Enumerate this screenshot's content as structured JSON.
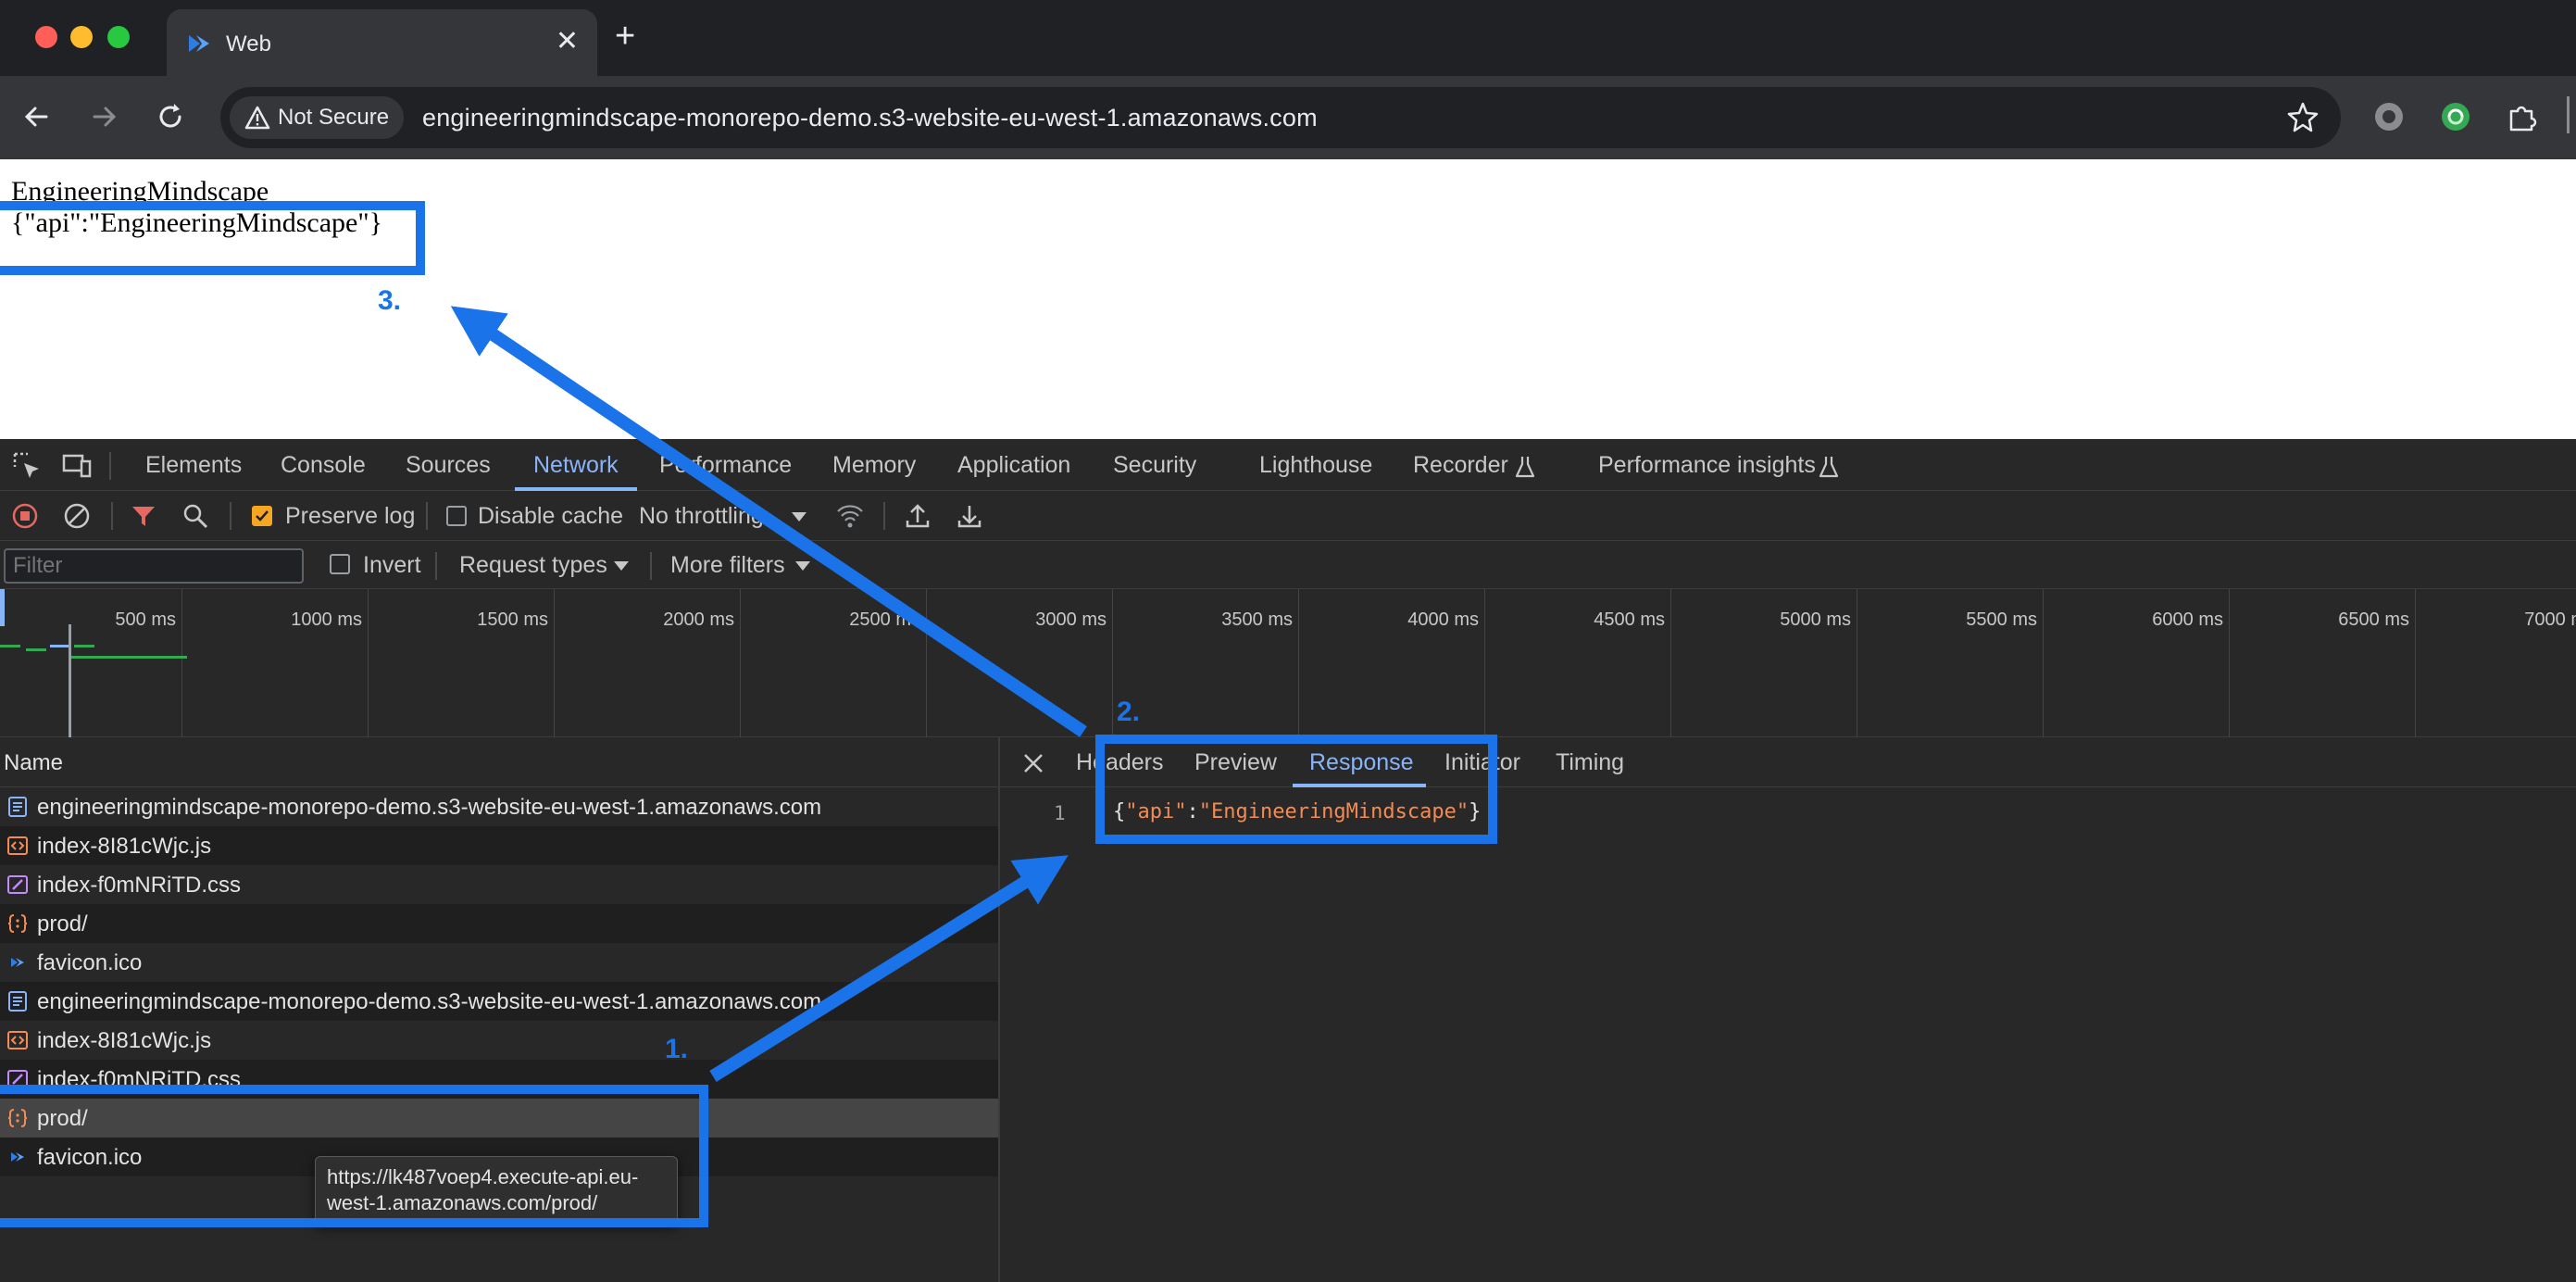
{
  "browser": {
    "tab_title": "Web",
    "tab_close": "✕",
    "new_tab": "+",
    "security_label": "Not Secure",
    "url": "engineeringmindscape-monorepo-demo.s3-website-eu-west-1.amazonaws.com"
  },
  "page": {
    "heading": "EngineeringMindscape",
    "json_text": "{\"api\":\"EngineeringMindscape\"}"
  },
  "devtools": {
    "tabs": [
      "Elements",
      "Console",
      "Sources",
      "Network",
      "Performance",
      "Memory",
      "Application",
      "Security",
      "Lighthouse",
      "Recorder",
      "Performance insights"
    ],
    "active_tab": "Network",
    "controls": {
      "preserve_log": "Preserve log",
      "disable_cache": "Disable cache",
      "throttling": "No throttling"
    },
    "filter": {
      "placeholder": "Filter",
      "invert": "Invert",
      "request_types": "Request types",
      "more_filters": "More filters"
    },
    "timeline_ticks": [
      "500 ms",
      "1000 ms",
      "1500 ms",
      "2000 ms",
      "2500 ms",
      "3000 ms",
      "3500 ms",
      "4000 ms",
      "4500 ms",
      "5000 ms",
      "5500 ms",
      "6000 ms",
      "6500 ms",
      "7000 ms"
    ],
    "name_header": "Name",
    "requests": [
      {
        "name": "engineeringmindscape-monorepo-demo.s3-website-eu-west-1.amazonaws.com",
        "type": "document"
      },
      {
        "name": "index-8I81cWjc.js",
        "type": "script"
      },
      {
        "name": "index-f0mNRiTD.css",
        "type": "stylesheet"
      },
      {
        "name": "prod/",
        "type": "fetch"
      },
      {
        "name": "favicon.ico",
        "type": "image"
      },
      {
        "name": "engineeringmindscape-monorepo-demo.s3-website-eu-west-1.amazonaws.com",
        "type": "document"
      },
      {
        "name": "index-8I81cWjc.js",
        "type": "script"
      },
      {
        "name": "index-f0mNRiTD.css",
        "type": "stylesheet"
      },
      {
        "name": "prod/",
        "type": "fetch"
      },
      {
        "name": "favicon.ico",
        "type": "image"
      }
    ],
    "detail_tabs": [
      "Headers",
      "Preview",
      "Response",
      "Initiator",
      "Timing"
    ],
    "active_detail_tab": "Response",
    "response": {
      "line_number": "1",
      "open_brace": "{",
      "key": "\"api\"",
      "colon": ":",
      "value": "\"EngineeringMindscape\"",
      "close_brace": "}"
    },
    "tooltip": "https://lk487voep4.execute-api.eu-west-1.amazonaws.com/prod/"
  },
  "annotations": {
    "step1": "1.",
    "step2": "2.",
    "step3": "3."
  },
  "colors": {
    "annotation_blue": "#1a73e8",
    "active_tab_blue": "#8ab4f8",
    "json_string_orange": "#f28b54"
  }
}
